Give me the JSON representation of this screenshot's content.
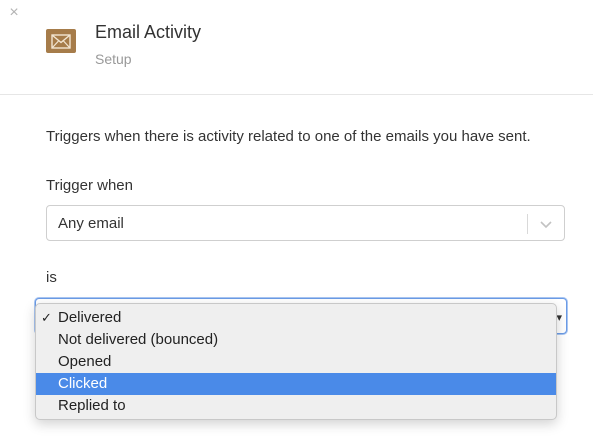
{
  "header": {
    "close_icon": "×",
    "title": "Email Activity",
    "subtitle": "Setup",
    "app_icon": "envelope-icon",
    "app_icon_color": "#a67c4a"
  },
  "main": {
    "description": "Triggers when there is activity related to one of the emails you have sent.",
    "trigger_label": "Trigger when",
    "trigger_select": {
      "value": "Any email",
      "chevron_icon": "chevron-down-icon"
    },
    "is_label": "is",
    "status_dropdown": {
      "options": [
        {
          "label": "Delivered",
          "checked": true,
          "highlighted": false
        },
        {
          "label": "Not delivered (bounced)",
          "checked": false,
          "highlighted": false
        },
        {
          "label": "Opened",
          "checked": false,
          "highlighted": false
        },
        {
          "label": "Clicked",
          "checked": false,
          "highlighted": true
        },
        {
          "label": "Replied to",
          "checked": false,
          "highlighted": false
        }
      ],
      "check_mark": "✓",
      "highlight_color": "#4a8ae8"
    }
  }
}
